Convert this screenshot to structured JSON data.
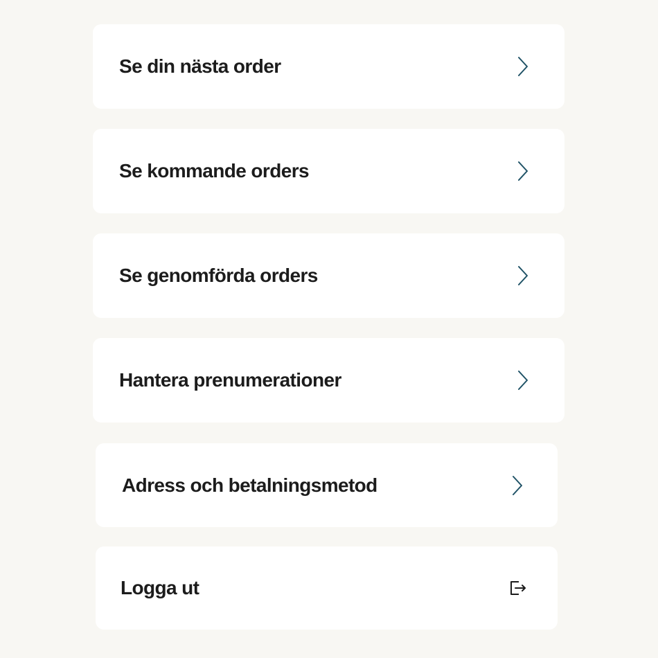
{
  "menu": {
    "items": [
      {
        "label": "Se din nästa order",
        "icon": "chevron-right-icon"
      },
      {
        "label": "Se kommande orders",
        "icon": "chevron-right-icon"
      },
      {
        "label": "Se genomförda orders",
        "icon": "chevron-right-icon"
      },
      {
        "label": "Hantera prenumerationer",
        "icon": "chevron-right-icon"
      },
      {
        "label": "Adress och betalningsmetod",
        "icon": "chevron-right-icon"
      },
      {
        "label": "Logga ut",
        "icon": "logout-icon"
      }
    ]
  },
  "colors": {
    "background": "#f8f7f3",
    "card": "#ffffff",
    "text": "#1c1c1c",
    "icon": "#1f5266"
  }
}
